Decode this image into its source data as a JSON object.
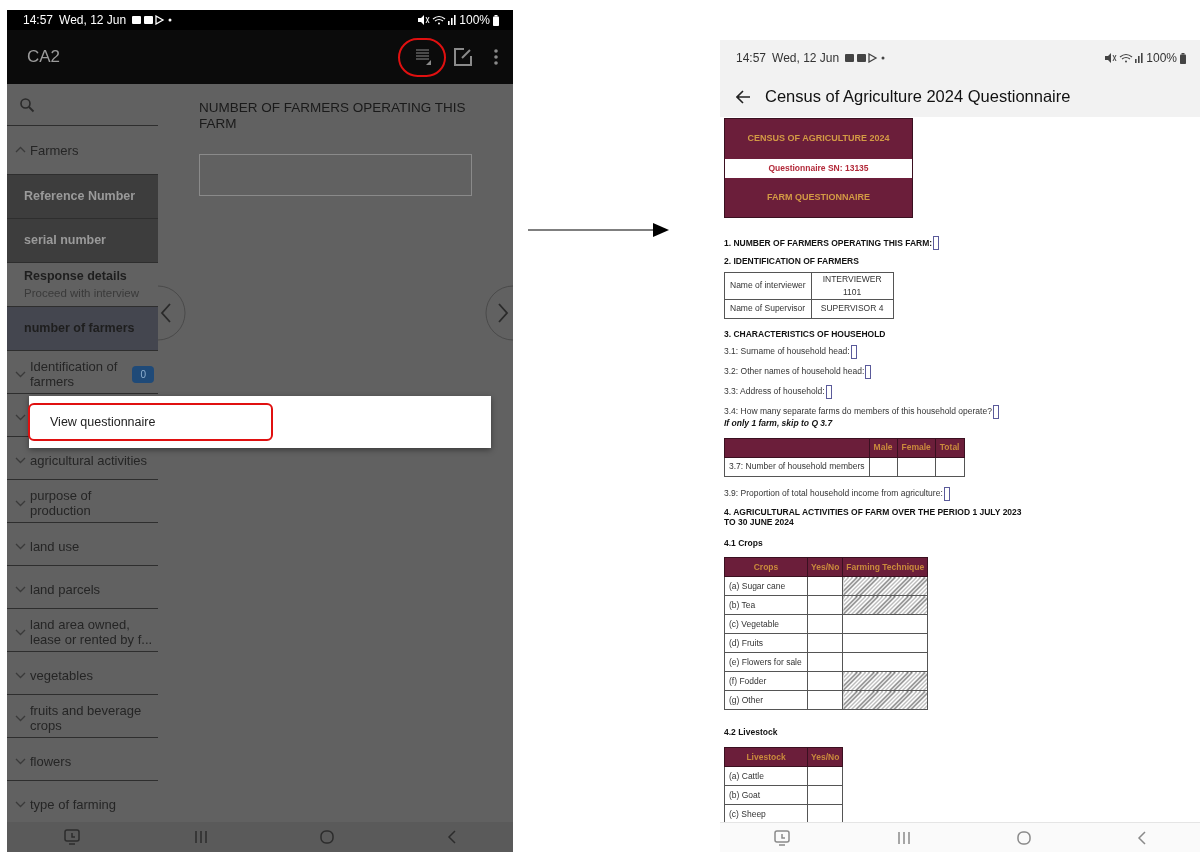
{
  "left_screen": {
    "status_bar": {
      "time": "14:57",
      "date": "Wed, 12 Jun",
      "battery": "100%"
    },
    "app_bar": {
      "title": "CA2",
      "actions": [
        {
          "kind": "view",
          "highlighted": true
        },
        {
          "kind": "edit",
          "highlighted": false
        },
        {
          "kind": "more",
          "highlighted": false
        }
      ]
    },
    "sidebar": {
      "items": [
        {
          "kind": "section",
          "label": "Farmers",
          "expanded": true
        },
        {
          "kind": "entry",
          "label": "Reference Number",
          "disabled": true,
          "selected": false
        },
        {
          "kind": "entry",
          "label": "serial number",
          "disabled": true,
          "selected": false
        },
        {
          "kind": "entry",
          "label": "Response details",
          "subtitle": "Proceed with interview",
          "disabled": false,
          "selected": false
        },
        {
          "kind": "entry",
          "label": "number of farmers",
          "disabled": false,
          "selected": true
        },
        {
          "kind": "section",
          "label": "Identification of farmers",
          "expanded": false,
          "badge": "0"
        },
        {
          "kind": "section",
          "expanded": false
        },
        {
          "kind": "section",
          "label": "agricultural activities",
          "expanded": false
        },
        {
          "kind": "section",
          "label": "purpose of production",
          "expanded": false
        },
        {
          "kind": "section",
          "label": "land use",
          "expanded": false
        },
        {
          "kind": "section",
          "label": "land parcels",
          "expanded": false
        },
        {
          "kind": "section",
          "label": "land area owned, lease or rented by f...",
          "expanded": false
        },
        {
          "kind": "section",
          "label": "vegetables",
          "expanded": false
        },
        {
          "kind": "section",
          "label": "fruits and beverage crops",
          "expanded": false
        },
        {
          "kind": "section",
          "label": "flowers",
          "expanded": false
        },
        {
          "kind": "section",
          "label": "type of farming",
          "expanded": false
        }
      ]
    },
    "question": {
      "label": "NUMBER OF FARMERS OPERATING THIS FARM"
    },
    "popup_menu": {
      "items": [
        {
          "label": "View questionnaire",
          "highlighted": true
        }
      ]
    }
  },
  "right_screen": {
    "status_bar": {
      "time": "14:57",
      "date": "Wed, 12 Jun",
      "battery": "100%"
    },
    "title_bar": {
      "title": "Census of Agriculture 2024 Questionnaire"
    },
    "banner": {
      "title": "CENSUS OF AGRICULTURE 2024",
      "serial": "Questionnaire SN: 13135",
      "subtitle": "FARM QUESTIONNAIRE"
    },
    "blocks": [
      {
        "kind": "heading",
        "text": "1. NUMBER OF FARMERS OPERATING THIS FARM:",
        "answer_box": true
      },
      {
        "kind": "heading",
        "text": "2. IDENTIFICATION OF FARMERS",
        "answer_box": false
      },
      {
        "kind": "info_table",
        "rows": [
          [
            "Name of interviewer",
            "INTERVIEWER 1101"
          ],
          [
            "Name of Supervisor",
            "SUPERVISOR 4"
          ]
        ]
      },
      {
        "kind": "heading",
        "text": "3. CHARACTERISTICS OF HOUSEHOLD",
        "answer_box": false
      },
      {
        "kind": "question",
        "text": "3.1: Surname of household head:"
      },
      {
        "kind": "question",
        "text": "3.2: Other names of household head:"
      },
      {
        "kind": "question",
        "text": "3.3: Address of household:"
      },
      {
        "kind": "question",
        "text": "3.4: How many separate farms do members of this household operate?",
        "note": "If only 1 farm, skip to Q 3.7"
      },
      {
        "kind": "grid_table",
        "columns": [
          "Male",
          "Female",
          "Total"
        ],
        "rows": [
          {
            "label": "3.7: Number of household members"
          }
        ]
      },
      {
        "kind": "question",
        "text": "3.9: Proportion of total household income from agriculture:"
      },
      {
        "kind": "heading",
        "text": "4. AGRICULTURAL ACTIVITIES OF FARM OVER THE PERIOD 1 JULY 2023 TO 30 JUNE 2024",
        "answer_box": false
      },
      {
        "kind": "subheading",
        "text": "4.1 Crops"
      },
      {
        "kind": "list_table",
        "columns": [
          "Crops",
          "Yes/No",
          "Farming Technique"
        ],
        "rows": [
          {
            "label": "(a) Sugar cane",
            "hatched": true
          },
          {
            "label": "(b) Tea",
            "hatched": true
          },
          {
            "label": "(c) Vegetable",
            "hatched": false
          },
          {
            "label": "(d) Fruits",
            "hatched": false
          },
          {
            "label": "(e) Flowers for sale",
            "hatched": false
          },
          {
            "label": "(f) Fodder",
            "hatched": true
          },
          {
            "label": "(g) Other",
            "hatched": true
          }
        ]
      },
      {
        "kind": "subheading",
        "text": "4.2 Livestock"
      },
      {
        "kind": "list_table",
        "columns": [
          "Livestock",
          "Yes/No"
        ],
        "rows": [
          {
            "label": "(a) Cattle"
          },
          {
            "label": "(b) Goat"
          },
          {
            "label": "(c) Sheep"
          }
        ]
      }
    ]
  }
}
